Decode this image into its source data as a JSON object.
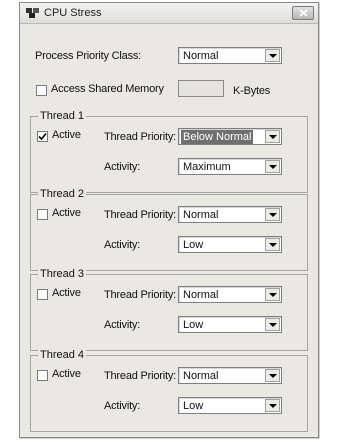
{
  "window": {
    "title": "CPU Stress",
    "icon": "cpu-stress-icon",
    "close_icon": "close-icon"
  },
  "general": {
    "priority_label": "Process Priority Class:",
    "priority_value": "Normal",
    "shared_memory_label": "Access Shared Memory",
    "shared_memory_checked": false,
    "shared_memory_value": "",
    "kbytes_label": "K-Bytes"
  },
  "threads": [
    {
      "title": "Thread 1",
      "active_label": "Active",
      "active": true,
      "priority_label": "Thread Priority:",
      "priority_value": "Below Normal",
      "activity_label": "Activity:",
      "activity_value": "Maximum"
    },
    {
      "title": "Thread 2",
      "active_label": "Active",
      "active": false,
      "priority_label": "Thread Priority:",
      "priority_value": "Normal",
      "activity_label": "Activity:",
      "activity_value": "Low"
    },
    {
      "title": "Thread 3",
      "active_label": "Active",
      "active": false,
      "priority_label": "Thread Priority:",
      "priority_value": "Normal",
      "activity_label": "Activity:",
      "activity_value": "Low"
    },
    {
      "title": "Thread 4",
      "active_label": "Active",
      "active": false,
      "priority_label": "Thread Priority:",
      "priority_value": "Normal",
      "activity_label": "Activity:",
      "activity_value": "Low"
    }
  ],
  "colors": {
    "window_bg": "#e9e8e3",
    "selection_bg": "#6f6f6f"
  }
}
